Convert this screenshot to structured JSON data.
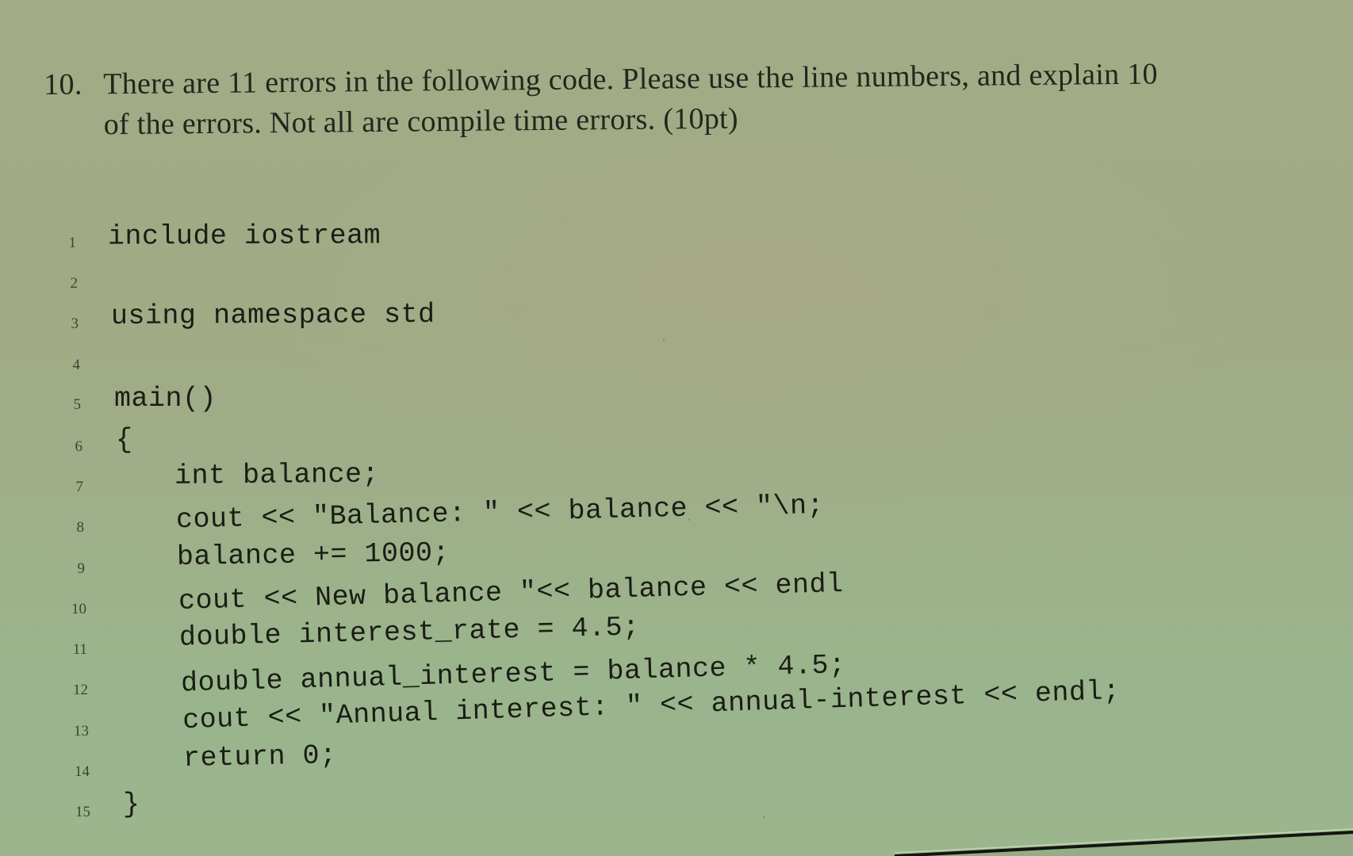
{
  "question": {
    "number": "10.",
    "lines": [
      "There are 11 errors in the following code. Please use the line numbers, and explain 10",
      "of the errors. Not all are compile time errors. (10pt)"
    ]
  },
  "code": {
    "lines": [
      {
        "num": "1",
        "text": "include iostream"
      },
      {
        "num": "2",
        "text": ""
      },
      {
        "num": "3",
        "text": "using namespace std"
      },
      {
        "num": "4",
        "text": ""
      },
      {
        "num": "5",
        "text": "main()"
      },
      {
        "num": "6",
        "text": "{"
      },
      {
        "num": "7",
        "text": "    int balance;"
      },
      {
        "num": "8",
        "text": "    cout << \"Balance: \" << balance << \"\\n;"
      },
      {
        "num": "9",
        "text": "    balance += 1000;"
      },
      {
        "num": "10",
        "text": "    cout << New balance \"<< balance << endl"
      },
      {
        "num": "11",
        "text": "    double interest_rate = 4.5;"
      },
      {
        "num": "12",
        "text": "    double annual_interest = balance * 4.5;"
      },
      {
        "num": "13",
        "text": "    cout << \"Annual interest: \" << annual-interest << endl;"
      },
      {
        "num": "14",
        "text": "    return 0;"
      },
      {
        "num": "15",
        "text": "}"
      }
    ]
  },
  "colors": {
    "paper_top": "#a2ab86",
    "paper_bottom": "#9bb58d",
    "ink": "#1a1d14"
  }
}
